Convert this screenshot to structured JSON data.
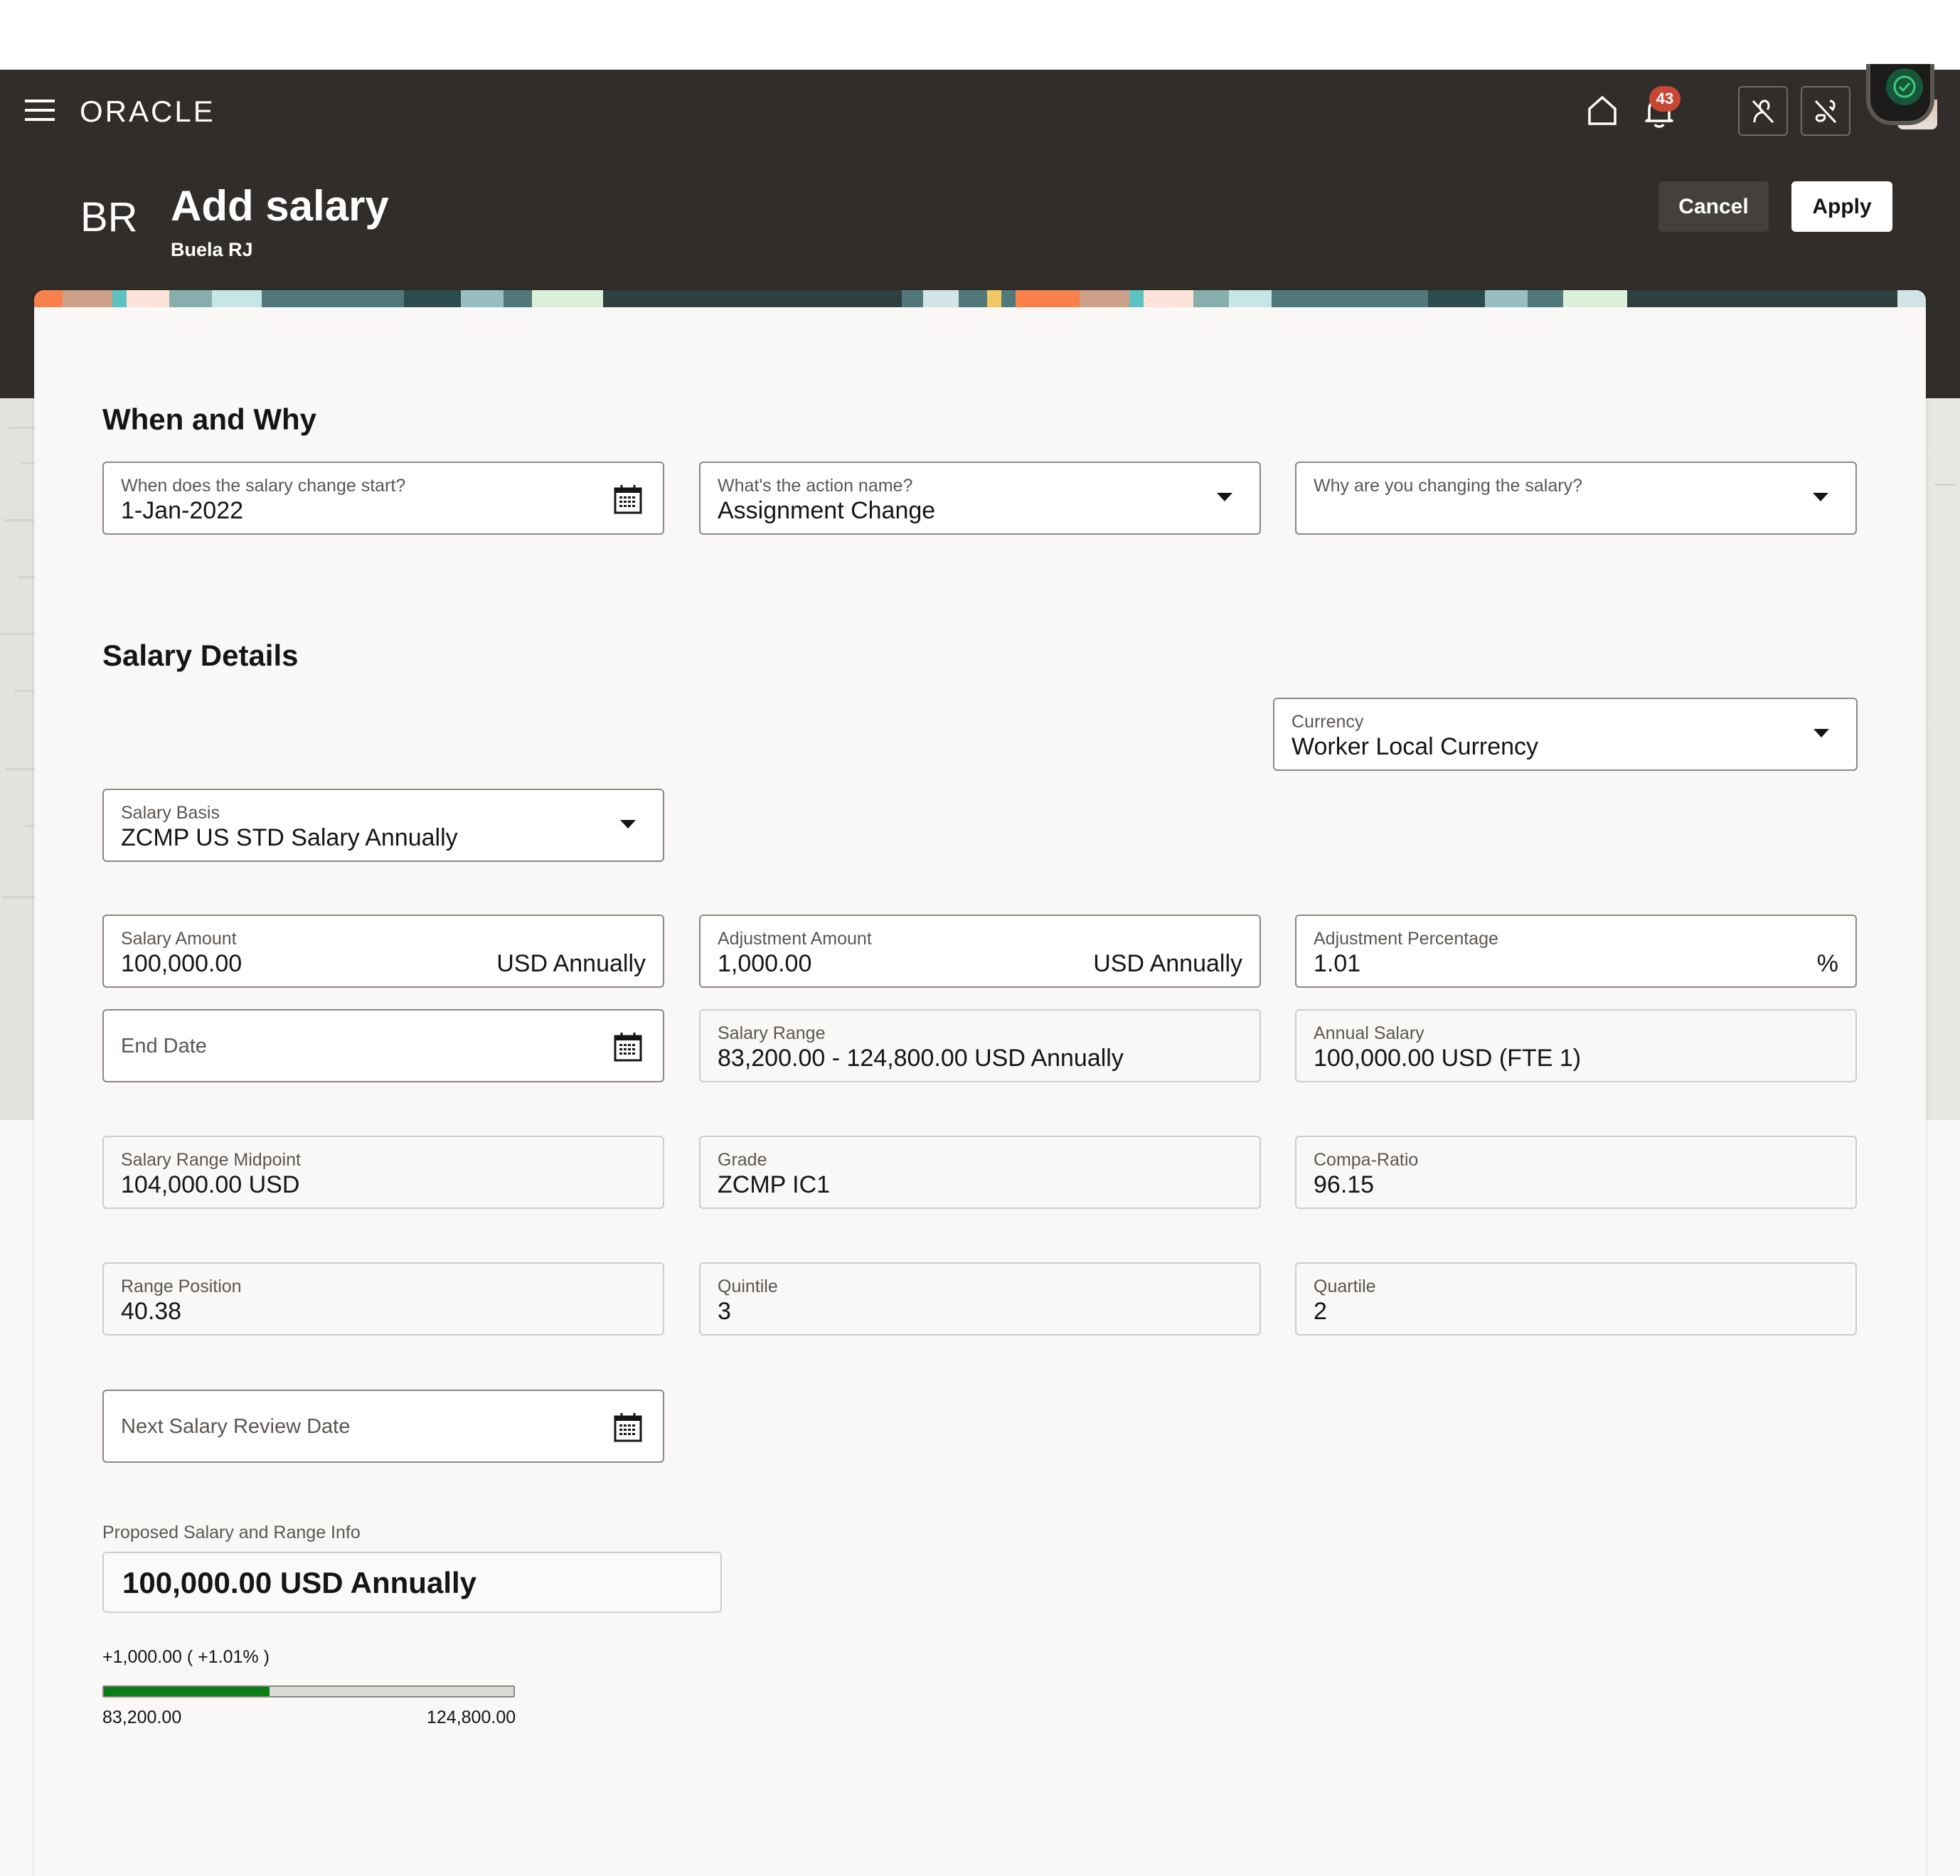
{
  "header": {
    "brand": "ORACLE",
    "notification_count": "43",
    "initials": "BR",
    "title": "Add salary",
    "subtitle": "Buela RJ",
    "cancel_label": "Cancel",
    "apply_label": "Apply"
  },
  "colors": {
    "header_bg": "#312d2a",
    "badge": "#c74634",
    "progress_fill": "#0a7d14",
    "status_green": "#16563a"
  },
  "sections": {
    "when_why": "When and Why",
    "salary_details": "Salary Details"
  },
  "when_why": {
    "start_date": {
      "label": "When does the salary change start?",
      "value": "1-Jan-2022"
    },
    "action_name": {
      "label": "What's the action name?",
      "value": "Assignment Change"
    },
    "reason": {
      "label": "Why are you changing the salary?",
      "value": ""
    }
  },
  "salary": {
    "currency": {
      "label": "Currency",
      "value": "Worker Local Currency"
    },
    "salary_basis": {
      "label": "Salary Basis",
      "value": "ZCMP US STD Salary Annually"
    },
    "salary_amount": {
      "label": "Salary Amount",
      "value": "100,000.00",
      "suffix": "USD Annually"
    },
    "adjustment_amount": {
      "label": "Adjustment Amount",
      "value": "1,000.00",
      "suffix": "USD Annually"
    },
    "adjustment_percentage": {
      "label": "Adjustment Percentage",
      "value": "1.01",
      "suffix": "%"
    },
    "end_date": {
      "placeholder": "End Date"
    },
    "salary_range": {
      "label": "Salary Range",
      "value": "83,200.00 - 124,800.00 USD Annually"
    },
    "annual_salary": {
      "label": "Annual Salary",
      "value": "100,000.00 USD (FTE 1)"
    },
    "range_midpoint": {
      "label": "Salary Range Midpoint",
      "value": "104,000.00 USD"
    },
    "grade": {
      "label": "Grade",
      "value": "ZCMP IC1"
    },
    "compa_ratio": {
      "label": "Compa-Ratio",
      "value": "96.15"
    },
    "range_position": {
      "label": "Range Position",
      "value": "40.38"
    },
    "quintile": {
      "label": "Quintile",
      "value": "3"
    },
    "quartile": {
      "label": "Quartile",
      "value": "2"
    },
    "next_review_date": {
      "placeholder": "Next Salary Review Date"
    }
  },
  "proposed": {
    "label": "Proposed Salary and Range Info",
    "value": "100,000.00 USD Annually",
    "change": "+1,000.00 ( +1.01% )",
    "range_min": "83,200.00",
    "range_max": "124,800.00",
    "position_percent": 40.38
  }
}
